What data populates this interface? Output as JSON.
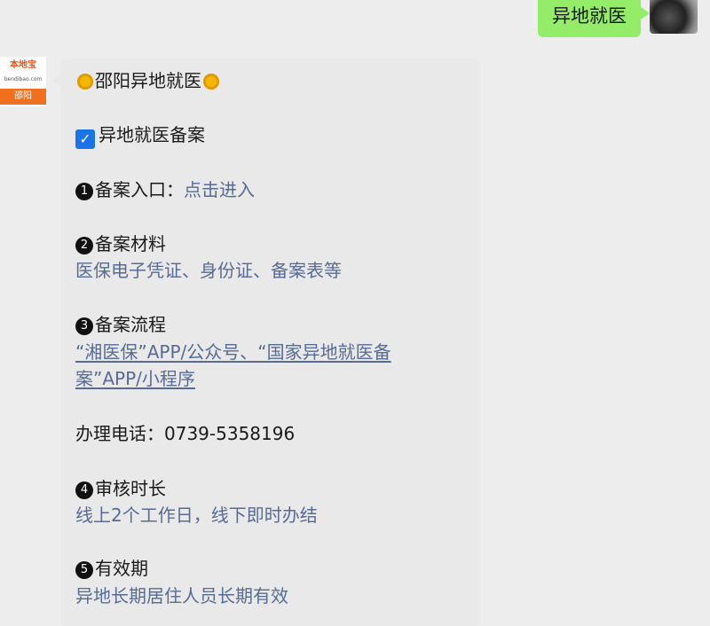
{
  "user_message": {
    "text": "异地就医"
  },
  "bot_avatar": {
    "brand": "本地宝",
    "subtext": "bendibao.com",
    "city": "邵阳"
  },
  "reply": {
    "title": "邵阳异地就医",
    "subtitle": "异地就医备案",
    "item1": {
      "number": "1",
      "label": "备案入口：",
      "link": "点击进入"
    },
    "item2": {
      "number": "2",
      "label": "备案材料",
      "value": "医保电子凭证、身份证、备案表等"
    },
    "item3": {
      "number": "3",
      "label": "备案流程",
      "link_line1": "“湘医保”APP/公众号、“国家异地就医备",
      "link_line2": "案”APP/小程序"
    },
    "phone": "办理电话：0739-5358196",
    "item4": {
      "number": "4",
      "label": "审核时长",
      "value": "线上2个工作日，线下即时办结"
    },
    "item5": {
      "number": "5",
      "label": "有效期",
      "value": "异地长期居住人员长期有效"
    }
  }
}
